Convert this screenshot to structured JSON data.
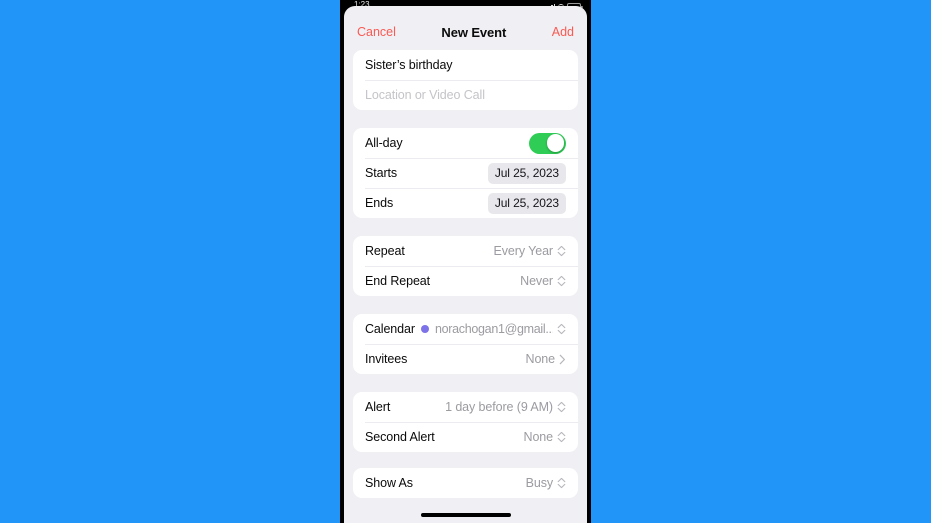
{
  "background_color": "#2196f8",
  "statusbar": {
    "time": "1:23",
    "signal_icon": "cellular-signal-icon",
    "wifi_icon": "wifi-icon",
    "battery_icon": "battery-icon"
  },
  "navbar": {
    "cancel_label": "Cancel",
    "title": "New Event",
    "add_label": "Add",
    "accent_color": "#fa5a52"
  },
  "details": {
    "title_value": "Sister’s birthday",
    "location_placeholder": "Location or Video Call"
  },
  "schedule": {
    "allday_label": "All-day",
    "allday_on": true,
    "allday_color": "#2fcc56",
    "starts_label": "Starts",
    "starts_value": "Jul 25, 2023",
    "ends_label": "Ends",
    "ends_value": "Jul 25, 2023"
  },
  "repeat": {
    "repeat_label": "Repeat",
    "repeat_value": "Every Year",
    "end_repeat_label": "End Repeat",
    "end_repeat_value": "Never"
  },
  "calendar": {
    "calendar_label": "Calendar",
    "calendar_value": "norachogan1@gmail....",
    "calendar_dot_color": "#7d72e8",
    "invitees_label": "Invitees",
    "invitees_value": "None"
  },
  "alerts": {
    "alert_label": "Alert",
    "alert_value": "1 day before (9 AM)",
    "second_alert_label": "Second Alert",
    "second_alert_value": "None"
  },
  "availability": {
    "show_as_label": "Show As",
    "show_as_value": "Busy"
  }
}
